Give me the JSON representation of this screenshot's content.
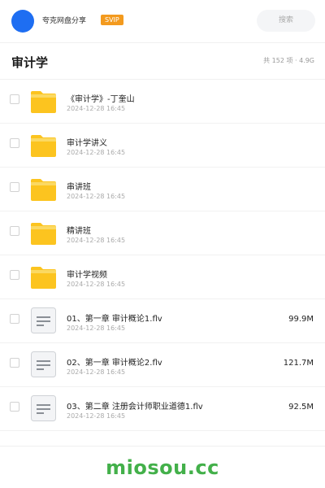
{
  "header": {
    "username": "夸克网盘分享",
    "badge": "SVIP",
    "search_placeholder": "搜索"
  },
  "folder": {
    "title": "审计学",
    "summary": "共 152 项 · 4.9G"
  },
  "files": [
    {
      "type": "folder",
      "icon": "folder-icon",
      "name": "《审计学》-丁奎山",
      "date": "2024-12-28 16:45",
      "size": ""
    },
    {
      "type": "folder",
      "icon": "folder-icon",
      "name": "审计学讲义",
      "date": "2024-12-28 16:45",
      "size": ""
    },
    {
      "type": "folder",
      "icon": "folder-icon",
      "name": "串讲班",
      "date": "2024-12-28 16:45",
      "size": ""
    },
    {
      "type": "folder",
      "icon": "folder-icon",
      "name": "精讲班",
      "date": "2024-12-28 16:45",
      "size": ""
    },
    {
      "type": "folder",
      "icon": "folder-icon",
      "name": "审计学视频",
      "date": "2024-12-28 16:45",
      "size": ""
    },
    {
      "type": "file",
      "icon": "document-icon",
      "name": "01、第一章 审计概论1.flv",
      "date": "2024-12-28 16:45",
      "size": "99.9M"
    },
    {
      "type": "file",
      "icon": "document-icon",
      "name": "02、第一章 审计概论2.flv",
      "date": "2024-12-28 16:45",
      "size": "121.7M"
    },
    {
      "type": "file",
      "icon": "document-icon",
      "name": "03、第二章 注册会计师职业道德1.flv",
      "date": "2024-12-28 16:45",
      "size": "92.5M"
    }
  ],
  "watermark": "miosou.cc",
  "colors": {
    "avatar": "#1e6ef2",
    "badge": "#f39a1e",
    "folder": "#fcc41f",
    "watermark": "#43b04a"
  }
}
